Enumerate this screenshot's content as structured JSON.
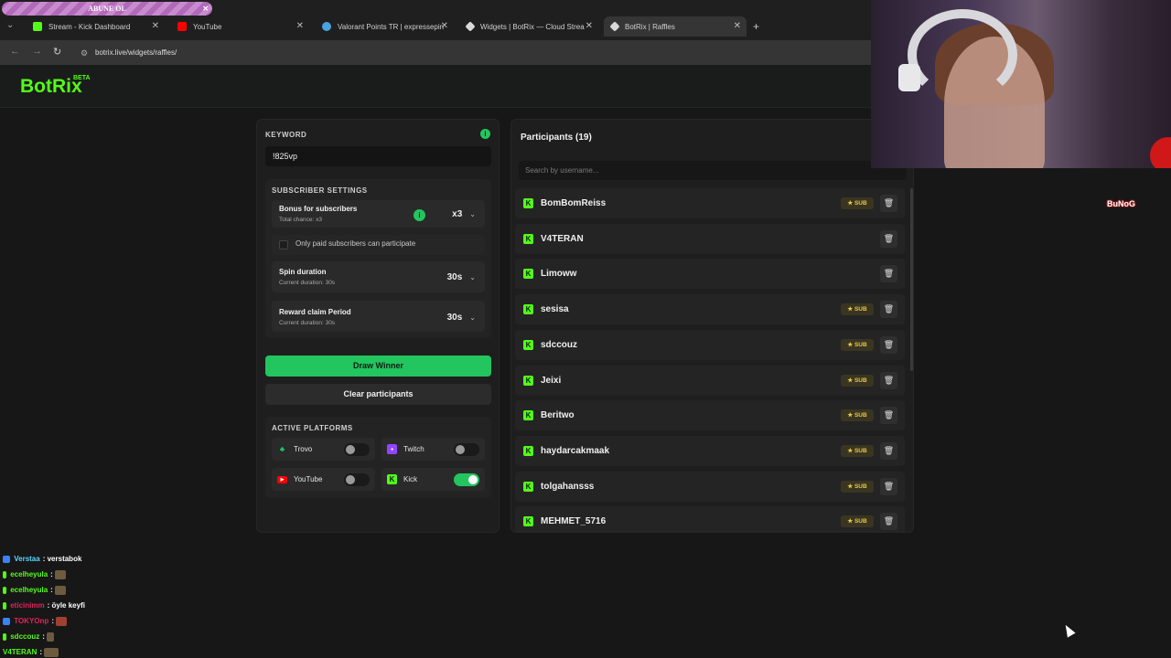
{
  "browser": {
    "promo_banner": "ABUNE OL",
    "tabs": [
      {
        "title": "Stream - Kick Dashboard",
        "icon_color": "#53fc18",
        "active": false
      },
      {
        "title": "YouTube",
        "icon_color": "#ff0000",
        "active": false
      },
      {
        "title": "Valorant Points TR | expressepin",
        "icon_color": "#4aa3df",
        "active": false
      },
      {
        "title": "Widgets | BotRix — Cloud Strea",
        "icon_color": "#d8d8d8",
        "active": false
      },
      {
        "title": "BotRix | Raffles",
        "icon_color": "#d8d8d8",
        "active": true
      }
    ],
    "new_tab": "+",
    "url": "botrix.live/widgets/raffles/"
  },
  "app": {
    "logo": "BotRix",
    "beta": "BETA"
  },
  "raffle": {
    "keyword_label": "KEYWORD",
    "keyword_value": "!825vp",
    "subscriber_settings_label": "SUBSCRIBER SETTINGS",
    "bonus_title": "Bonus for subscribers",
    "bonus_sub": "Total chance: x3",
    "bonus_value": "x3",
    "paid_only_label": "Only paid subscribers can participate",
    "spin_title": "Spin duration",
    "spin_sub": "Current duration: 30s",
    "spin_value": "30s",
    "reward_title": "Reward claim Period",
    "reward_sub": "Current duration: 30s",
    "reward_value": "30s",
    "draw_button": "Draw Winner",
    "clear_button": "Clear participants",
    "platforms_label": "ACTIVE PLATFORMS",
    "platforms": [
      {
        "name": "Trovo",
        "enabled": false,
        "color": "#19d66b"
      },
      {
        "name": "Twitch",
        "enabled": false,
        "color": "#9146ff"
      },
      {
        "name": "YouTube",
        "enabled": false,
        "color": "#ff0000"
      },
      {
        "name": "Kick",
        "enabled": true,
        "color": "#53fc18"
      }
    ]
  },
  "participants": {
    "title": "Participants (19)",
    "search_placeholder": "Search by username...",
    "sub_badge": "SUB",
    "list": [
      {
        "name": "BomBomReiss",
        "sub": true
      },
      {
        "name": "V4TERAN",
        "sub": false
      },
      {
        "name": "Limoww",
        "sub": false
      },
      {
        "name": "sesisa",
        "sub": true
      },
      {
        "name": "sdccouz",
        "sub": true
      },
      {
        "name": "Jeixi",
        "sub": true
      },
      {
        "name": "Beritwo",
        "sub": true
      },
      {
        "name": "haydarcakmaak",
        "sub": true
      },
      {
        "name": "tolgahansss",
        "sub": true
      },
      {
        "name": "MEHMET_5716",
        "sub": true
      }
    ]
  },
  "overlay": {
    "tag": "BuNoG"
  },
  "chat": [
    {
      "user": "Verstaa",
      "message": "verstabok",
      "color": "#5dd6ff",
      "emote": false
    },
    {
      "user": "ecelheyula",
      "message": "",
      "color": "#53fc18",
      "emote": true
    },
    {
      "user": "ecelheyula",
      "message": "",
      "color": "#53fc18",
      "emote": true
    },
    {
      "user": "eticinimm",
      "message": "öyle keyfi",
      "color": "#e0245e",
      "emote": false
    },
    {
      "user": "TOKYOnp",
      "message": "",
      "color": "#e0245e",
      "emote": true
    },
    {
      "user": "sdccouz",
      "message": "",
      "color": "#53fc18",
      "emote": true
    },
    {
      "user": "V4TERAN",
      "message": "",
      "color": "#53fc18",
      "emote": true
    }
  ]
}
